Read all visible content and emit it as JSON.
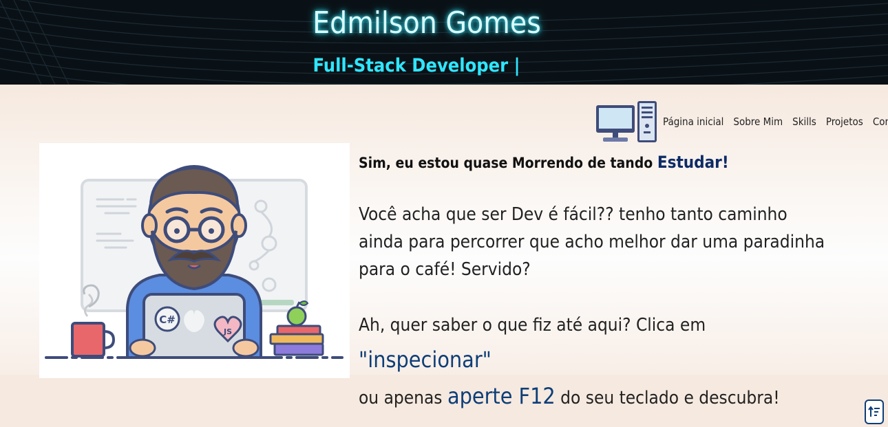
{
  "header": {
    "title": "Edmilson Gomes",
    "subtitle": "Full-Stack Developer |"
  },
  "nav": {
    "logo_icon": "desktop-computer-icon",
    "items": [
      {
        "label": "Página inicial"
      },
      {
        "label": "Sobre Mim"
      },
      {
        "label": "Skills"
      },
      {
        "label": "Projetos"
      },
      {
        "label": "Contato"
      }
    ]
  },
  "hero": {
    "illustration": "developer-at-laptop-illustration",
    "laptop_stickers": [
      "C#",
      "JS"
    ],
    "headline_prefix": "Sim, eu estou quase Morrendo de tando",
    "headline_accent": "Estudar!",
    "paragraph1": "Você acha que ser Dev é fácil?? tenho tanto caminho ainda para percorrer que acho melhor dar uma paradinha para o café! Servido?",
    "paragraph2_part1": "Ah, quer saber o que fiz até aqui? Clica em",
    "paragraph2_link1": "\"inspecionar\"",
    "paragraph2_part2": "ou apenas",
    "paragraph2_link2": "aperte F12",
    "paragraph2_part3": "do seu teclado e descubra!"
  },
  "back_to_top": {
    "icon": "sort-up-icon"
  },
  "colors": {
    "header_bg": "#0a1116",
    "title_glow": "#39e0f0",
    "subtitle": "#2fe6ff",
    "page_bg": "#f6e9df",
    "accent_blue": "#0d3e78"
  }
}
